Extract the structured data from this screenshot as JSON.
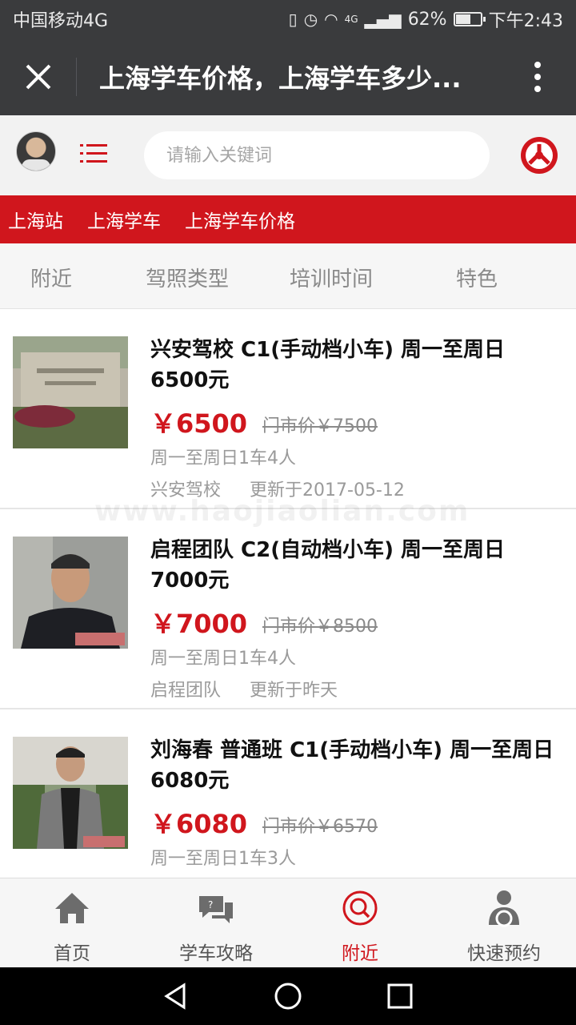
{
  "status_bar": {
    "carrier": "中国移动4G",
    "network": "4G",
    "battery": "62%",
    "battery_level": 0.62,
    "time": "下午2:43"
  },
  "title_bar": {
    "title": "上海学车价格，上海学车多少..."
  },
  "header": {
    "search_placeholder": "请输入关键词"
  },
  "breadcrumb": [
    "上海站",
    "上海学车",
    "上海学车价格"
  ],
  "filters": [
    "附近",
    "驾照类型",
    "培训时间",
    "特色"
  ],
  "listings": [
    {
      "title": "兴安驾校 C1(手动档小车) 周一至周日6500元",
      "price": "￥6500",
      "original_price": "门市价￥7500",
      "schedule": "周一至周日1车4人",
      "school": "兴安驾校",
      "updated": "更新于2017-05-12"
    },
    {
      "title": "启程团队 C2(自动档小车) 周一至周日7000元",
      "price": "￥7000",
      "original_price": "门市价￥8500",
      "schedule": "周一至周日1车4人",
      "school": "启程团队",
      "updated": "更新于昨天"
    },
    {
      "title": "刘海春 普通班 C1(手动档小车) 周一至周日6080元",
      "price": "￥6080",
      "original_price": "门市价￥6570",
      "schedule": "周一至周日1车3人",
      "school": "",
      "updated": ""
    }
  ],
  "watermark": "www.haojiaolian.com",
  "bottom_nav": [
    {
      "label": "首页",
      "icon": "home-icon",
      "active": false
    },
    {
      "label": "学车攻略",
      "icon": "chat-icon",
      "active": false
    },
    {
      "label": "附近",
      "icon": "search-icon",
      "active": true
    },
    {
      "label": "快速预约",
      "icon": "driver-icon",
      "active": false
    }
  ],
  "colors": {
    "brand_red": "#d0161d",
    "title_bar_bg": "#3a3b3d"
  }
}
